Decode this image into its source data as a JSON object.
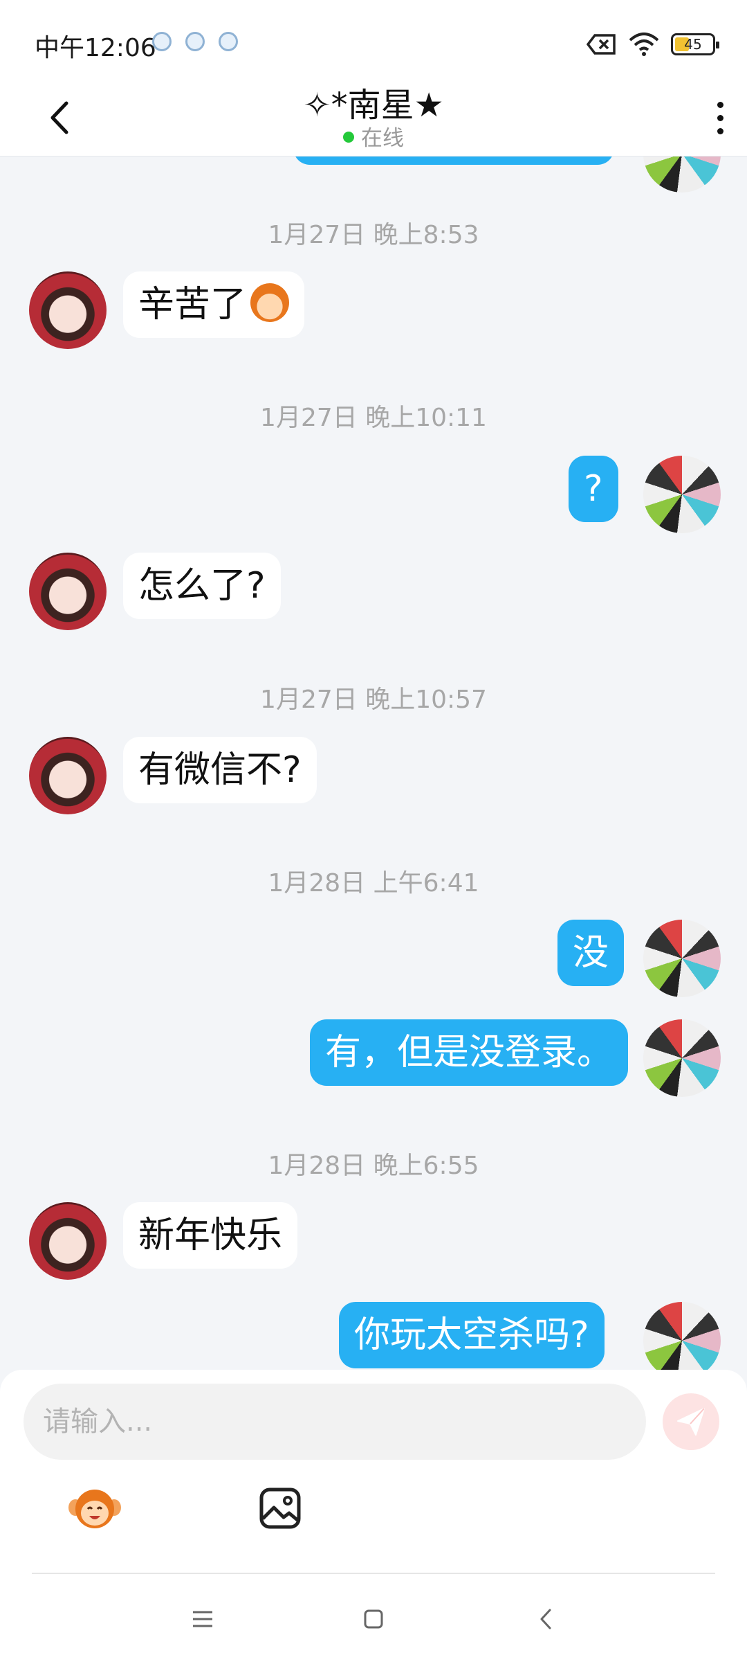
{
  "status_bar": {
    "time": "中午12:06",
    "battery": "45",
    "icons": [
      "notification-icon",
      "notification-icon",
      "notification-icon",
      "sim-blocked-icon",
      "wifi-icon",
      "battery-icon"
    ]
  },
  "header": {
    "title": "✧*南星★",
    "status": "在线",
    "status_color": "#24c93a"
  },
  "messages": [
    {
      "type": "timestamp",
      "text": "1月27日 晚上8:53"
    },
    {
      "type": "incoming",
      "text": "辛苦了",
      "emoji": "monkey-face-emoji"
    },
    {
      "type": "timestamp",
      "text": "1月27日 晚上10:11"
    },
    {
      "type": "outgoing",
      "text": "?"
    },
    {
      "type": "incoming",
      "text": "怎么了?"
    },
    {
      "type": "timestamp",
      "text": "1月27日 晚上10:57"
    },
    {
      "type": "incoming",
      "text": "有微信不?"
    },
    {
      "type": "timestamp",
      "text": "1月28日 上午6:41"
    },
    {
      "type": "outgoing",
      "text": "没"
    },
    {
      "type": "outgoing",
      "text": "有，但是没登录。"
    },
    {
      "type": "timestamp",
      "text": "1月28日 晚上6:55"
    },
    {
      "type": "incoming",
      "text": "新年快乐"
    },
    {
      "type": "outgoing",
      "text": "你玩太空杀吗?"
    }
  ],
  "input": {
    "placeholder": "请输入..."
  },
  "colors": {
    "accent": "#27b0f3",
    "background": "#f3f5f8",
    "send_button_bg": "#fde3e3"
  }
}
